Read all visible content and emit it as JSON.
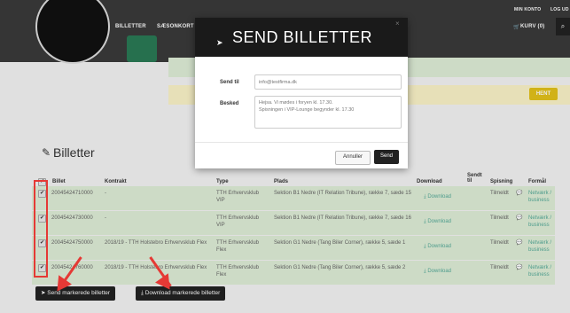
{
  "header": {
    "nav": [
      "BILLETTER",
      "SÆSONKORT"
    ],
    "account": "MIN KONTO",
    "logout": "LOG UD",
    "cart": "KURV (0)"
  },
  "yellow_strip": {
    "button": "HENT"
  },
  "section": {
    "title": "Billetter"
  },
  "table": {
    "columns": {
      "billet": "Billet",
      "kontrakt": "Kontrakt",
      "type": "Type",
      "plads": "Plads",
      "download": "Download",
      "sendt_til": "Sendt til",
      "spisning": "Spisning",
      "format": "Formål"
    },
    "rows": [
      {
        "billet": "20045424710000",
        "kontrakt": "-",
        "type": "TTH Erhvervsklub VIP",
        "plads": "Sektion B1 Nedre (IT Relation Tribune), række 7, sæde 15",
        "download": "Download",
        "spisning": "Tilmeldt",
        "format": "Netværk / business"
      },
      {
        "billet": "20045424730000",
        "kontrakt": "-",
        "type": "TTH Erhvervsklub VIP",
        "plads": "Sektion B1 Nedre (IT Relation Tribune), række 7, sæde 16",
        "download": "Download",
        "spisning": "Tilmeldt",
        "format": "Netværk / business"
      },
      {
        "billet": "20045424750000",
        "kontrakt": "2018/19 - TTH Holstebro Erhvervsklub Flex",
        "type": "TTH Erhvervsklub Flex",
        "plads": "Sektion G1 Nedre (Tang Biler Corner), række 5, sæde 1",
        "download": "Download",
        "spisning": "Tilmeldt",
        "format": "Netværk / business"
      },
      {
        "billet": "20045424760000",
        "kontrakt": "2018/19 - TTH Holstebro Erhvervsklub Flex",
        "type": "TTH Erhvervsklub Flex",
        "plads": "Sektion G1 Nedre (Tang Biler Corner), række 5, sæde 2",
        "download": "Download",
        "spisning": "Tilmeldt",
        "format": "Netværk / business"
      }
    ]
  },
  "actions": {
    "send": "Send markerede billetter",
    "download": "Download markerede billetter"
  },
  "modal": {
    "title": "SEND BILLETTER",
    "send_til_label": "Send til",
    "send_til_placeholder": "info@testfirma.dk",
    "besked_label": "Besked",
    "besked_line1": "Hejsa. Vi mødes i foryen kl. 17.30.",
    "besked_line2": "Spisningen i VIP-Lounge begynder kl. 17.30",
    "cancel": "Annuller",
    "send": "Send"
  },
  "colors": {
    "accent": "#e3c21b",
    "annotation": "#e53935",
    "row_bg": "#dfeed7",
    "header_bg": "#3a3a3a"
  }
}
